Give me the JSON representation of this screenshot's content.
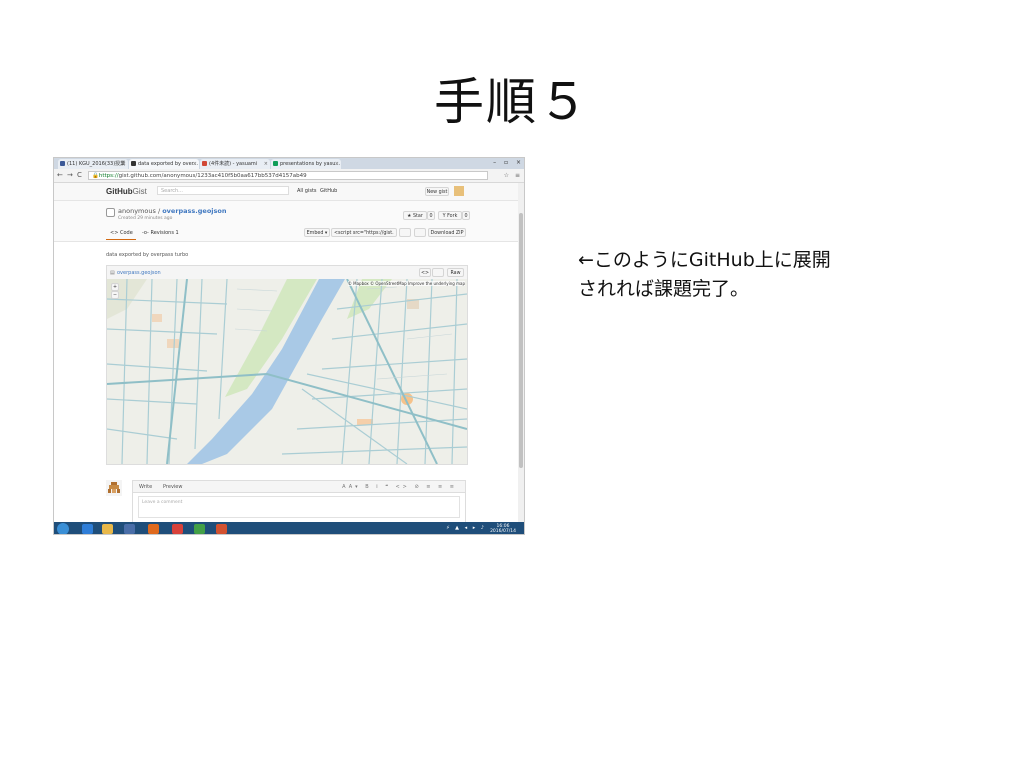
{
  "slide": {
    "title": "手順５",
    "caption_line1": "←このようにGitHub上に展開",
    "caption_line2": "されれば課題完了。"
  },
  "browser": {
    "tabs": [
      {
        "label": "(11) KGU_2016(33)授業",
        "fav_color": "#3b5998"
      },
      {
        "label": "data exported by over...",
        "fav_color": "#333333"
      },
      {
        "label": "(4件未読) - yasuami",
        "fav_color": "#d14836"
      },
      {
        "label": "presentations by yasu...",
        "fav_color": "#0f9d58"
      }
    ],
    "close_glyph": "×",
    "url_scheme": "https://",
    "url_rest": "gist.github.com/anonymous/1233ac410f5b0aa617bb537d4157ab49",
    "window_controls": "– ▫ ×",
    "nav_back": "←",
    "nav_forward": "→",
    "nav_reload": "C",
    "address_icons": "☆ ≡"
  },
  "gist": {
    "logo_bold": "GitHub",
    "logo_light": "Gist",
    "search_placeholder": "Search...",
    "nav_all_gists": "All gists",
    "nav_github": "GitHub",
    "new_gist": "New gist",
    "owner": "anonymous",
    "separator": " / ",
    "filename": "overpass.geojson",
    "created": "Created 29 minutes ago",
    "star_label": "★ Star",
    "star_count": "0",
    "fork_label": "Y Fork",
    "fork_count": "0",
    "tab_code": "<> Code",
    "tab_revisions": "-o- Revisions",
    "revisions_count": "1",
    "embed_label": "Embed ▾",
    "embed_code": "<script src=\"https://gist.",
    "download_zip": "Download ZIP",
    "description": "data exported by overpass turbo",
    "file_label": "overpass.geojson",
    "raw_label": "Raw",
    "code_icon": "<>",
    "map_attribution": "© Mapbox © OpenStreetMap Improve the underlying map",
    "zoom_in": "+",
    "zoom_out": "−"
  },
  "comment": {
    "tab_write": "Write",
    "tab_preview": "Preview",
    "tools": "AA▾ B i ❝ <> ⊘ ≡ ≡ ≡",
    "placeholder": "Leave a comment"
  },
  "taskbar": {
    "time": "16:06",
    "date": "2016/07/14",
    "tray": "⚡ ▲ ◂ ▸ ♪",
    "icons": [
      {
        "name": "ie",
        "color": "#2f7ed8"
      },
      {
        "name": "explorer",
        "color": "#e8b84a"
      },
      {
        "name": "media",
        "color": "#4a6ea8"
      },
      {
        "name": "firefox",
        "color": "#e06a1e"
      },
      {
        "name": "chrome",
        "color": "#d9423a"
      },
      {
        "name": "chrome-active",
        "color": "#43a047"
      },
      {
        "name": "powerpoint",
        "color": "#d35230"
      }
    ]
  }
}
